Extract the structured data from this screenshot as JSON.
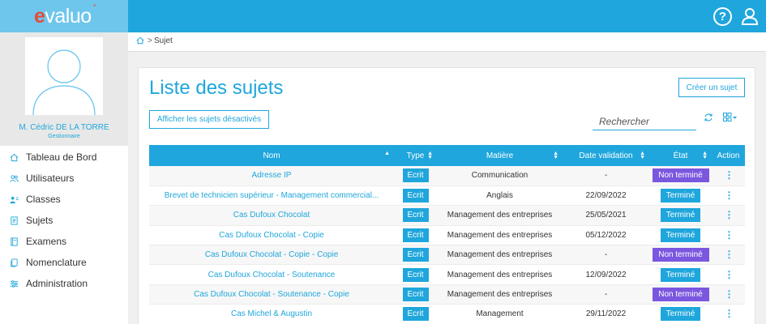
{
  "app": {
    "logo_text": "evaluo",
    "help_icon": "question-circle-icon",
    "user_icon": "user-icon"
  },
  "colors": {
    "brand": "#1fa6dc",
    "logo_area": "#6fc6ec",
    "logo_accent": "#e34b3a",
    "status_done": "#1fa6dc",
    "status_open": "#7b57e0"
  },
  "profile": {
    "name": "M. Cédric DE LA TORRE",
    "role": "Gestionnaire"
  },
  "sidebar": {
    "items": [
      {
        "label": "Tableau de Bord",
        "icon": "home-icon"
      },
      {
        "label": "Utilisateurs",
        "icon": "users-icon"
      },
      {
        "label": "Classes",
        "icon": "class-icon"
      },
      {
        "label": "Sujets",
        "icon": "document-icon"
      },
      {
        "label": "Examens",
        "icon": "book-icon"
      },
      {
        "label": "Nomenclature",
        "icon": "copy-icon"
      },
      {
        "label": "Administration",
        "icon": "sliders-icon"
      }
    ]
  },
  "breadcrumb": {
    "home_icon": "home-icon",
    "separator": ">",
    "current": "Sujet"
  },
  "main": {
    "title": "Liste des sujets",
    "create_button": "Créer un sujet",
    "show_disabled_button": "Afficher les sujets désactivés",
    "search_placeholder": "Rechercher",
    "refresh_icon": "refresh-icon",
    "view_toggle_icon": "grid-view-icon"
  },
  "table": {
    "headers": [
      "Nom",
      "Type",
      "Matière",
      "Date validation",
      "État",
      "Action"
    ],
    "rows": [
      {
        "name": "Adresse IP",
        "type": "Ecrit",
        "subject": "Communication",
        "date": "-",
        "status": "Non terminé",
        "status_kind": "open"
      },
      {
        "name": "Brevet de technicien supérieur - Management commercial...",
        "type": "Ecrit",
        "subject": "Anglais",
        "date": "22/09/2022",
        "status": "Terminé",
        "status_kind": "done"
      },
      {
        "name": "Cas Dufoux Chocolat",
        "type": "Ecrit",
        "subject": "Management des entreprises",
        "date": "25/05/2021",
        "status": "Terminé",
        "status_kind": "done"
      },
      {
        "name": "Cas Dufoux Chocolat - Copie",
        "type": "Ecrit",
        "subject": "Management des entreprises",
        "date": "05/12/2022",
        "status": "Terminé",
        "status_kind": "done"
      },
      {
        "name": "Cas Dufoux Chocolat - Copie - Copie",
        "type": "Ecrit",
        "subject": "Management des entreprises",
        "date": "-",
        "status": "Non terminé",
        "status_kind": "open"
      },
      {
        "name": "Cas Dufoux Chocolat - Soutenance",
        "type": "Ecrit",
        "subject": "Management des entreprises",
        "date": "12/09/2022",
        "status": "Terminé",
        "status_kind": "done"
      },
      {
        "name": "Cas Dufoux Chocolat - Soutenance - Copie",
        "type": "Ecrit",
        "subject": "Management des entreprises",
        "date": "-",
        "status": "Non terminé",
        "status_kind": "open"
      },
      {
        "name": "Cas Michel & Augustin",
        "type": "Ecrit",
        "subject": "Management",
        "date": "29/11/2022",
        "status": "Terminé",
        "status_kind": "done"
      }
    ]
  }
}
